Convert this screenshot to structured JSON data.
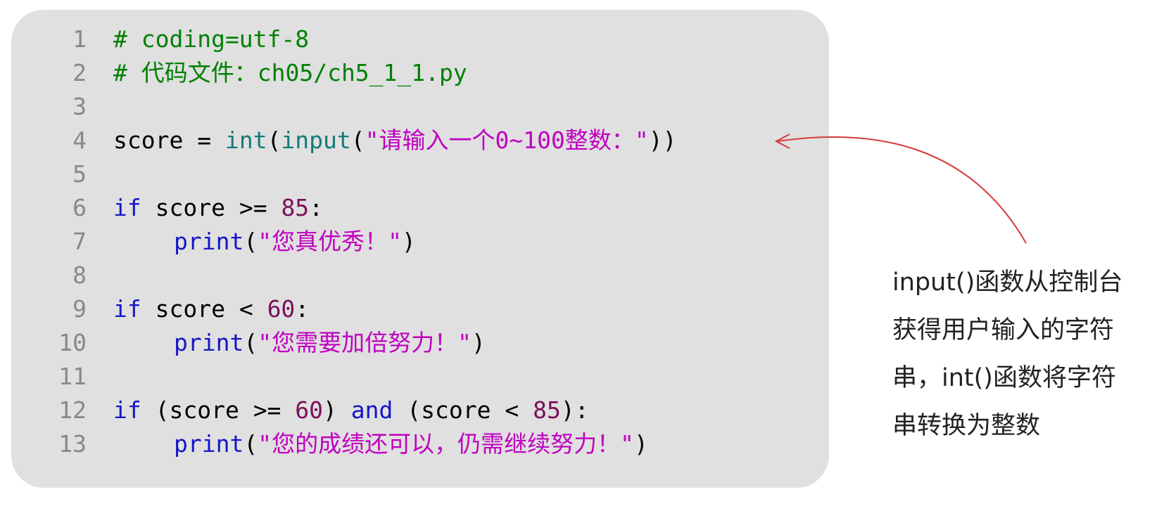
{
  "code": {
    "lines": [
      {
        "num": "1",
        "tokens": [
          {
            "t": "# coding=utf-8",
            "c": "cmt"
          }
        ]
      },
      {
        "num": "2",
        "tokens": [
          {
            "t": "# 代码文件：ch05/ch5_1_1.py",
            "c": "cmt"
          }
        ]
      },
      {
        "num": "3",
        "tokens": []
      },
      {
        "num": "4",
        "tokens": [
          {
            "t": "score = ",
            "c": "plain"
          },
          {
            "t": "int",
            "c": "bi"
          },
          {
            "t": "(",
            "c": "plain"
          },
          {
            "t": "input",
            "c": "bi"
          },
          {
            "t": "(",
            "c": "plain"
          },
          {
            "t": "\"请输入一个0~100整数：\"",
            "c": "str"
          },
          {
            "t": "))",
            "c": "plain"
          }
        ]
      },
      {
        "num": "5",
        "tokens": []
      },
      {
        "num": "6",
        "tokens": [
          {
            "t": "if",
            "c": "kw"
          },
          {
            "t": " score >= ",
            "c": "plain"
          },
          {
            "t": "85",
            "c": "num"
          },
          {
            "t": ":",
            "c": "plain"
          }
        ]
      },
      {
        "num": "7",
        "indent": true,
        "tokens": [
          {
            "t": "print",
            "c": "fn"
          },
          {
            "t": "(",
            "c": "plain"
          },
          {
            "t": "\"您真优秀！\"",
            "c": "str"
          },
          {
            "t": ")",
            "c": "plain"
          }
        ]
      },
      {
        "num": "8",
        "tokens": []
      },
      {
        "num": "9",
        "tokens": [
          {
            "t": "if",
            "c": "kw"
          },
          {
            "t": " score < ",
            "c": "plain"
          },
          {
            "t": "60",
            "c": "num"
          },
          {
            "t": ":",
            "c": "plain"
          }
        ]
      },
      {
        "num": "10",
        "indent": true,
        "tokens": [
          {
            "t": "print",
            "c": "fn"
          },
          {
            "t": "(",
            "c": "plain"
          },
          {
            "t": "\"您需要加倍努力！\"",
            "c": "str"
          },
          {
            "t": ")",
            "c": "plain"
          }
        ]
      },
      {
        "num": "11",
        "tokens": []
      },
      {
        "num": "12",
        "tokens": [
          {
            "t": "if",
            "c": "kw"
          },
          {
            "t": " (score >= ",
            "c": "plain"
          },
          {
            "t": "60",
            "c": "num"
          },
          {
            "t": ") ",
            "c": "plain"
          },
          {
            "t": "and",
            "c": "kw"
          },
          {
            "t": " (score < ",
            "c": "plain"
          },
          {
            "t": "85",
            "c": "num"
          },
          {
            "t": "):",
            "c": "plain"
          }
        ]
      },
      {
        "num": "13",
        "indent": true,
        "tokens": [
          {
            "t": "print",
            "c": "fn"
          },
          {
            "t": "(",
            "c": "plain"
          },
          {
            "t": "\"您的成绩还可以，仍需继续努力！\"",
            "c": "str"
          },
          {
            "t": ")",
            "c": "plain"
          }
        ]
      }
    ]
  },
  "annotation": {
    "lines": [
      "input()函数从控制台",
      "获得用户输入的字符",
      "串，int()函数将字符",
      "串转换为整数"
    ]
  },
  "colors": {
    "panel_bg": "#e0e0e0",
    "comment": "#008000",
    "keyword": "#1515c8",
    "builtin": "#147a7a",
    "string": "#c000c0",
    "number": "#7a0f5c",
    "line_number": "#888888",
    "arrow": "#d83a3a"
  }
}
